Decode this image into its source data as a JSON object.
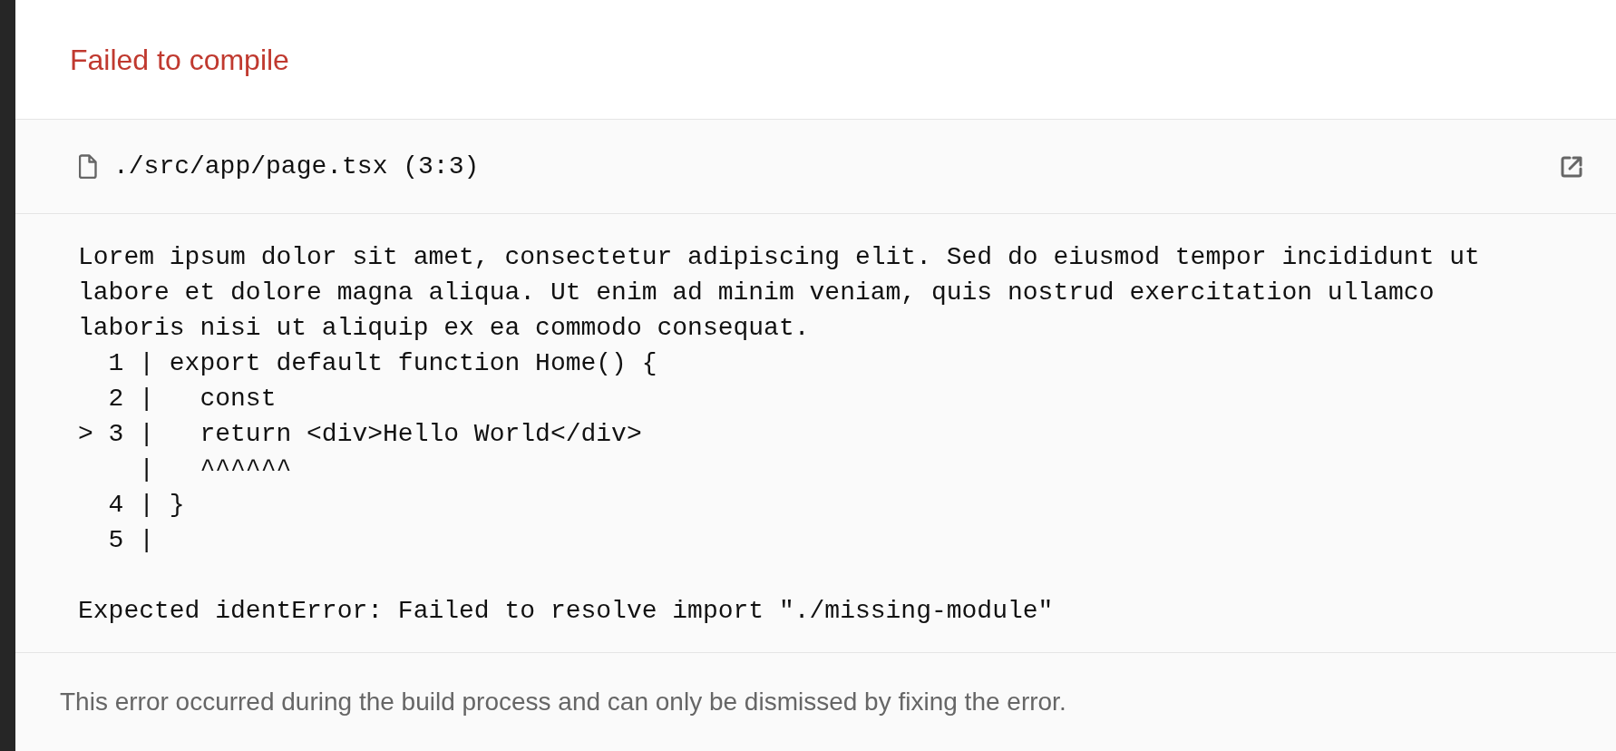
{
  "title": "Failed to compile",
  "file": {
    "path": "./src/app/page.tsx (3:3)"
  },
  "message_lines": [
    "Lorem ipsum dolor sit amet, consectetur adipiscing elit. Sed do eiusmod tempor incididunt ut",
    "labore et dolore magna aliqua. Ut enim ad minim veniam, quis nostrud exercitation ullamco",
    "laboris nisi ut aliquip ex ea commodo consequat."
  ],
  "code_lines": [
    "  1 | export default function Home() {",
    "  2 |   const",
    "> 3 |   return <div>Hello World</div>",
    "    |   ^^^^^^",
    "  4 | }",
    "  5 |"
  ],
  "error_line": "Expected identError: Failed to resolve import \"./missing-module\"",
  "footer": "This error occurred during the build process and can only be dismissed by fixing the error."
}
